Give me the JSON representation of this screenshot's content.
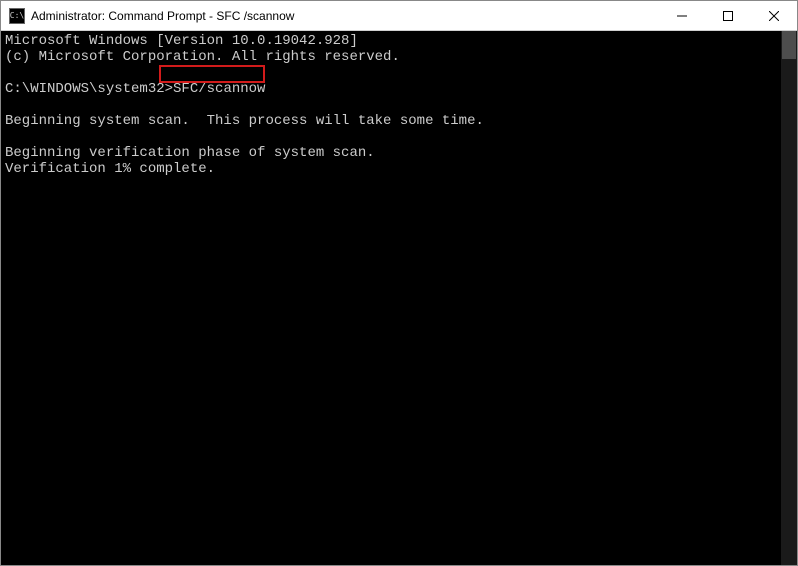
{
  "window": {
    "title": "Administrator: Command Prompt - SFC /scannow",
    "icon_label": "C:\\"
  },
  "terminal": {
    "line1": "Microsoft Windows [Version 10.0.19042.928]",
    "line2": "(c) Microsoft Corporation. All rights reserved.",
    "blank1": "",
    "prompt_path": "C:\\WINDOWS\\system32>",
    "command": "SFC/scannow",
    "blank2": "",
    "scan1": "Beginning system scan.  This process will take some time.",
    "blank3": "",
    "scan2": "Beginning verification phase of system scan.",
    "scan3": "Verification 1% complete."
  }
}
